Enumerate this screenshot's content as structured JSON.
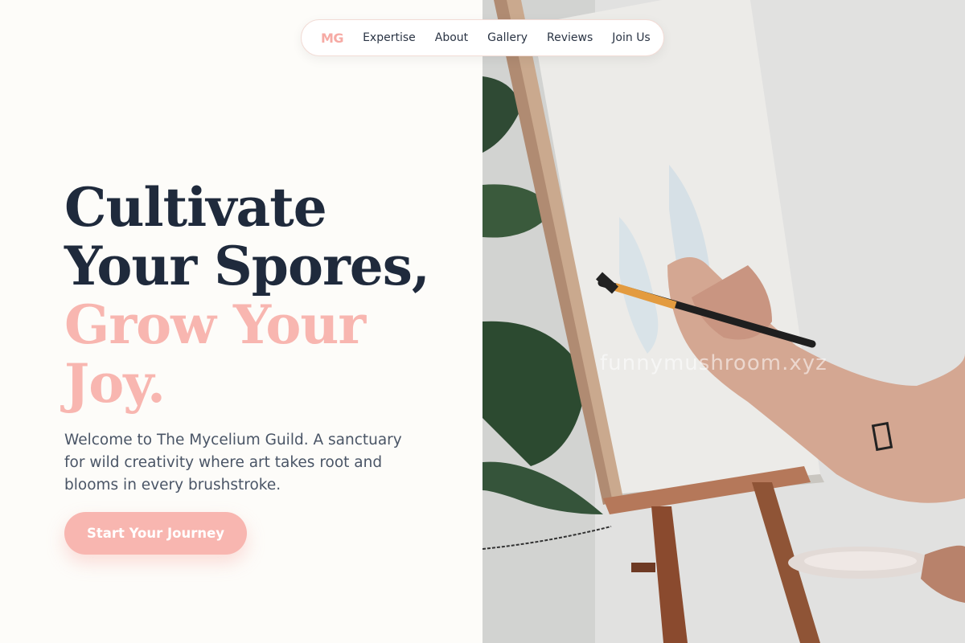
{
  "nav": {
    "logo": "MG",
    "links": [
      "Expertise",
      "About",
      "Gallery",
      "Reviews",
      "Join Us"
    ]
  },
  "hero": {
    "headline_line1": "Cultivate",
    "headline_line2": "Your Spores,",
    "headline_line3": "Grow Your",
    "headline_line4": "Joy.",
    "lede": "Welcome to The Mycelium Guild. A sanctuary for wild creativity where art takes root and blooms in every brushstroke.",
    "cta_label": "Start Your Journey"
  },
  "image": {
    "watermark": "funnymushroom.xyz"
  },
  "colors": {
    "accent": "#f8b6b0",
    "dark_text": "#1f2a3c",
    "body_text": "#4a5566",
    "background": "#fdfcf9"
  }
}
